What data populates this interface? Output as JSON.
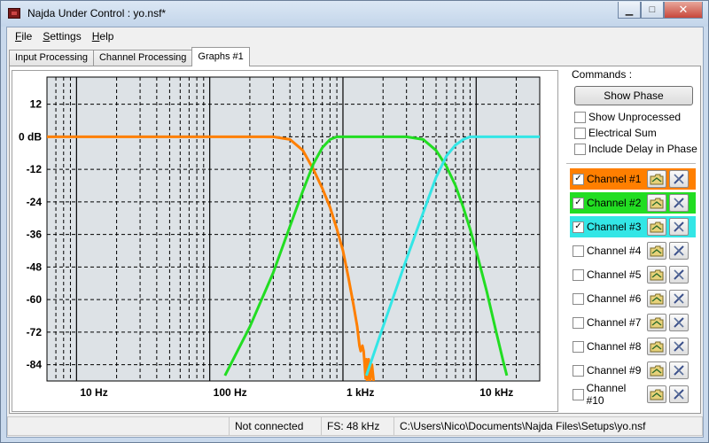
{
  "window": {
    "title": "Najda Under Control : yo.nsf*",
    "controls": {
      "minimize": "▁",
      "maximize": "□",
      "close": "✕"
    }
  },
  "menu": {
    "items": [
      {
        "label": "File",
        "mnemonic": "F",
        "rest": "ile"
      },
      {
        "label": "Settings",
        "mnemonic": "S",
        "rest": "ettings"
      },
      {
        "label": "Help",
        "mnemonic": "H",
        "rest": "elp"
      }
    ]
  },
  "tabs": [
    {
      "label": "Input Processing",
      "active": false
    },
    {
      "label": "Channel Processing",
      "active": false
    },
    {
      "label": "Graphs #1",
      "active": true
    }
  ],
  "graph": {
    "y_ticks": [
      "12",
      "0 dB",
      "-12",
      "-24",
      "-36",
      "-48",
      "-60",
      "-72",
      "-84"
    ],
    "y_values": [
      12,
      0,
      -12,
      -24,
      -36,
      -48,
      -60,
      -72,
      -84
    ],
    "x_labels": [
      "10 Hz",
      "100 Hz",
      "1 kHz",
      "10 kHz"
    ],
    "x_range_hz": [
      6,
      30000
    ],
    "y_range_db": [
      -90,
      22
    ],
    "background_color": "#dde2e6",
    "curves": [
      {
        "color": "#ff7f00",
        "points": [
          [
            6,
            0
          ],
          [
            300,
            0
          ],
          [
            400,
            -1
          ],
          [
            500,
            -5
          ],
          [
            600,
            -12
          ],
          [
            700,
            -19
          ],
          [
            800,
            -26
          ],
          [
            900,
            -34
          ],
          [
            1000,
            -42
          ],
          [
            1100,
            -52
          ],
          [
            1200,
            -62
          ],
          [
            1280,
            -70
          ],
          [
            1330,
            -77
          ],
          [
            1360,
            -79
          ],
          [
            1400,
            -77
          ],
          [
            1430,
            -79
          ],
          [
            1460,
            -85
          ],
          [
            1480,
            -89
          ],
          [
            1500,
            -82
          ],
          [
            1520,
            -90
          ],
          [
            1560,
            -82
          ],
          [
            1600,
            -90
          ],
          [
            1650,
            -84
          ],
          [
            1700,
            -90
          ]
        ]
      },
      {
        "color": "#22dd22",
        "points": [
          [
            130,
            -88
          ],
          [
            200,
            -70
          ],
          [
            300,
            -50
          ],
          [
            400,
            -33
          ],
          [
            500,
            -20
          ],
          [
            600,
            -10
          ],
          [
            700,
            -4
          ],
          [
            800,
            -1
          ],
          [
            900,
            0
          ],
          [
            3000,
            0
          ],
          [
            4000,
            -1
          ],
          [
            5000,
            -5
          ],
          [
            6000,
            -11
          ],
          [
            7000,
            -18
          ],
          [
            8000,
            -26
          ],
          [
            9000,
            -34
          ],
          [
            10000,
            -42
          ],
          [
            12000,
            -57
          ],
          [
            14000,
            -71
          ],
          [
            16000,
            -83
          ],
          [
            17000,
            -88
          ]
        ]
      },
      {
        "color": "#33e6e6",
        "points": [
          [
            1500,
            -88
          ],
          [
            2000,
            -70
          ],
          [
            3000,
            -45
          ],
          [
            4000,
            -28
          ],
          [
            5000,
            -15
          ],
          [
            6000,
            -7
          ],
          [
            7000,
            -3
          ],
          [
            8000,
            -1
          ],
          [
            9000,
            0
          ],
          [
            30000,
            0
          ]
        ]
      }
    ]
  },
  "commands": {
    "title": "Commands :",
    "show_phase": "Show Phase",
    "options": [
      {
        "label": "Show Unprocessed",
        "checked": false
      },
      {
        "label": "Electrical Sum",
        "checked": false
      },
      {
        "label": "Include Delay in Phase",
        "checked": false
      }
    ],
    "channels": [
      {
        "label": "Channel #1",
        "checked": true,
        "color": "#ff7f00"
      },
      {
        "label": "Channel #2",
        "checked": true,
        "color": "#22dd22"
      },
      {
        "label": "Channel #3",
        "checked": true,
        "color": "#33e6e6"
      },
      {
        "label": "Channel #4",
        "checked": false,
        "color": ""
      },
      {
        "label": "Channel #5",
        "checked": false,
        "color": ""
      },
      {
        "label": "Channel #6",
        "checked": false,
        "color": ""
      },
      {
        "label": "Channel #7",
        "checked": false,
        "color": ""
      },
      {
        "label": "Channel #8",
        "checked": false,
        "color": ""
      },
      {
        "label": "Channel #9",
        "checked": false,
        "color": ""
      },
      {
        "label": "Channel #10",
        "checked": false,
        "color": ""
      }
    ],
    "check_mark": "✓"
  },
  "status": {
    "connection": "Not connected",
    "sample_rate": "FS: 48 kHz",
    "file_path": "C:\\Users\\Nico\\Documents\\Najda Files\\Setups\\yo.nsf"
  }
}
